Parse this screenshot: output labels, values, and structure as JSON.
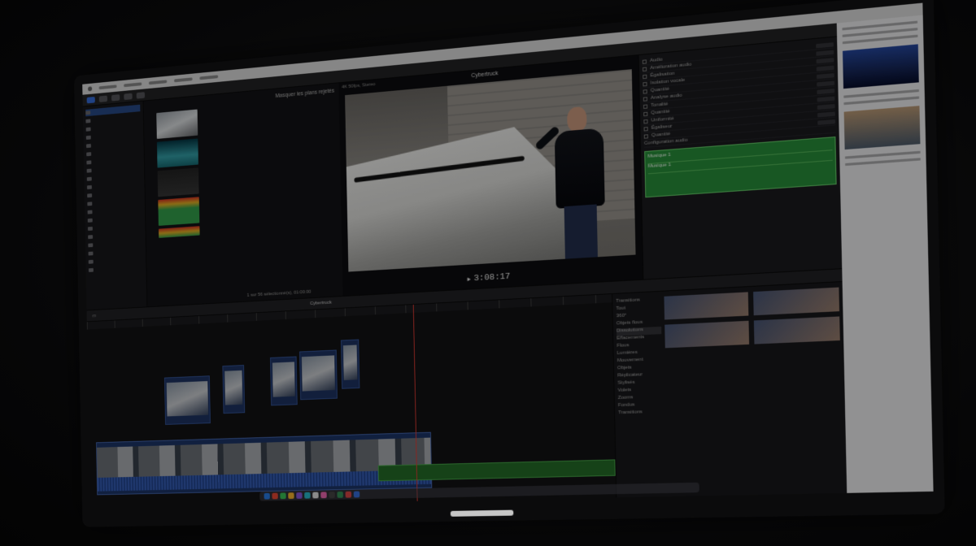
{
  "viewer": {
    "clip_name": "Cybertruck",
    "left_info": "4K 50fps, Stereo",
    "zoom": "49 %",
    "view_menu": "Visionner",
    "timecode": "3:08:17"
  },
  "browser": {
    "header": "Masquer les plans rejetés",
    "footer": "1 sur 56 sélectionné(s), 01:00:00"
  },
  "inspector": {
    "rows": [
      "Audio",
      "Amélioration audio",
      "Égalisation",
      "Isolation vocale",
      "Quantité",
      "Analyse audio",
      "Tonalité",
      "Quantité",
      "Uniformité",
      "Égaliseur",
      "Quantité"
    ],
    "roles_header": "Configuration audio",
    "roles": [
      "Musique 1",
      "Musique 1"
    ]
  },
  "timeline": {
    "project": "Cybertruck"
  },
  "transitions": {
    "header": "Transitions",
    "items": [
      "Tout",
      "360°",
      "Objets flous",
      "Dissolutions",
      "Effacements",
      "Flous",
      "Lumières",
      "Mouvement",
      "Objets",
      "Réplicateur",
      "Stylisés",
      "Volets",
      "Zooms",
      "Fondus",
      "Transitions"
    ]
  },
  "colors": {
    "accent_blue": "#3b6fd6",
    "audio_green": "#2c6f2e",
    "playhead_red": "#e0413a",
    "video_blue": "#243b6b"
  }
}
